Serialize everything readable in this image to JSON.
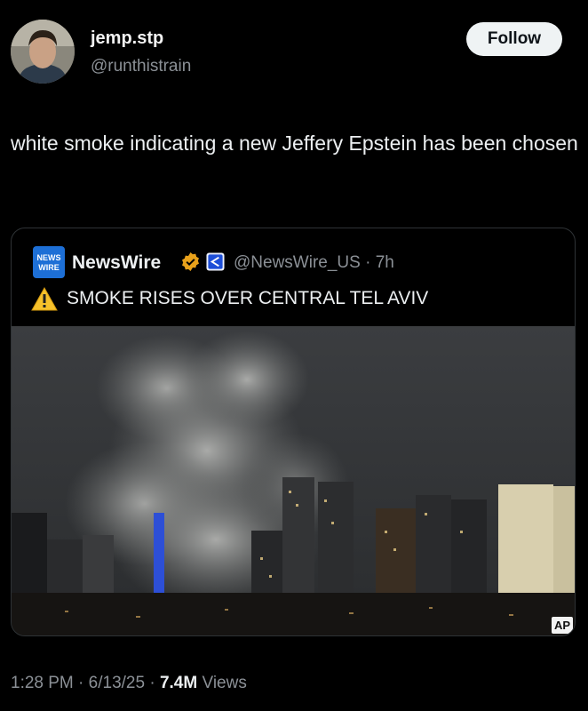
{
  "author": {
    "display_name": "jemp.stp",
    "handle": "@runthistrain",
    "avatar_icon": "profile-photo"
  },
  "follow_label": "Follow",
  "tweet": {
    "text": "white smoke indicating a new Jeffery Epstein has been chosen"
  },
  "quoted": {
    "logo_text_top": "NEWS",
    "logo_text_bottom": "WIRE",
    "name": "NewsWire",
    "meta": "@NewsWire_US · 7h",
    "warning_icon": "warning-triangle",
    "headline": "SMOKE RISES OVER CENTRAL TEL AVIV",
    "image_badge": "AP"
  },
  "footer": {
    "time": "1:28 PM",
    "date": "6/13/25",
    "views_count": "7.4M",
    "views_label": "Views"
  },
  "colors": {
    "background": "#000000",
    "secondary_text": "#8b9096",
    "verified_gold": "#e8a11b",
    "affiliate_blue": "#1d4ed8"
  }
}
